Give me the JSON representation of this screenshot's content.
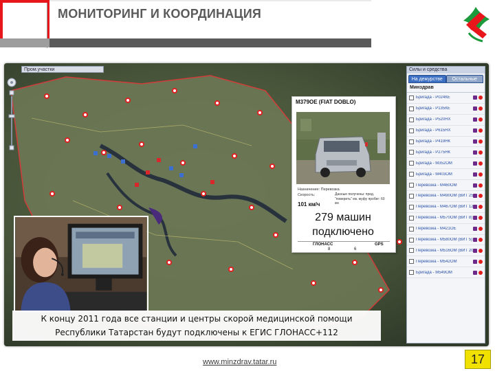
{
  "header": {
    "title": "МОНИТОРИНГ И КООРДИНАЦИЯ"
  },
  "colors": {
    "brand_red": "#e8151b",
    "header_gray": "#5a5a5a",
    "page_badge": "#f1e100"
  },
  "map": {
    "layer_label": "Пром.участки",
    "zoom_icon": "zoom-slider-icon"
  },
  "panel": {
    "title": "Силы и средства",
    "tabs": [
      "На дежурстве",
      "Остальные"
    ],
    "section": "Минздрав",
    "items": [
      "Бригада - Р024КЕ",
      "Бригада - Р135КЕ",
      "Бригада - Р520НХ",
      "Бригада - Р615НХ",
      "Бригада - Р419НК",
      "Бригада - Р275НК",
      "Бригада - М352ОМ",
      "Бригада - М403ОМ",
      "Перевозка - М460ОМ",
      "Перевозка - М490ОМ (ВИТ 25)",
      "Перевозка - М467ОМ (ВИТ 12)",
      "Перевозка - М570ОМ (ВИТ 8)",
      "Перевозка - М421ОЕ",
      "Перевозка - М580ОМ (ВИТ 5)",
      "Перевозка - М516ОМ (ВИТ 20)",
      "Перевозка - М542ОМ",
      "Бригада - М549ОМ"
    ]
  },
  "card": {
    "title": "М379ОЕ (FIAT DOBLO)",
    "subtitle": "Назначение: Перевозка",
    "speed_label": "Скорость:",
    "data_text": "Данные получены: пред. \"поверить\" км. муфу пробег: 60 км",
    "speed": "101 км/ч",
    "glonass_label": "ГЛОНАСС",
    "gps_label": "GPS",
    "glonass_count": "8",
    "gps_count": "6"
  },
  "overlay": {
    "line1": "279 машин",
    "line2": "подключено"
  },
  "caption": {
    "line1": "К концу 2011 года все станции и центры скорой медицинской помощи",
    "line2": "Республики Татарстан будут подключены к ЕГИС ГЛОНАСС+112"
  },
  "footer": {
    "url": "www.minzdrav.tatar.ru",
    "page_number": "17"
  }
}
